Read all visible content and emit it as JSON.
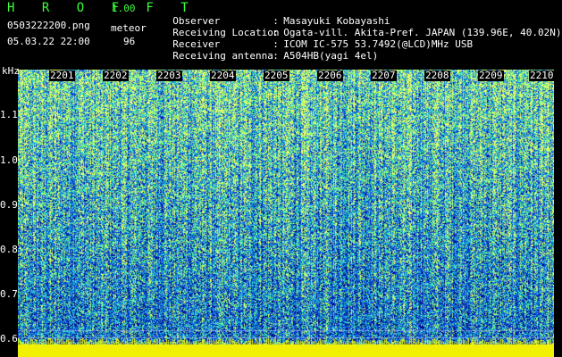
{
  "header": {
    "app_title": "H R O F F T",
    "version": "1.00",
    "filename": "0503222200.png",
    "mode": "meteor",
    "datetime": "05.03.22 22:00",
    "count": "96"
  },
  "info": [
    {
      "key": "Observer",
      "value": "Masayuki Kobayashi"
    },
    {
      "key": "Receiving Location",
      "value": "Ogata-vill. Akita-Pref. JAPAN (139.96E, 40.02N)"
    },
    {
      "key": "Receiver",
      "value": "ICOM IC-575 53.7492(@LCD)MHz USB"
    },
    {
      "key": "Receiving antenna",
      "value": "A504HB(yagi 4el)"
    }
  ],
  "info_separator": ":",
  "spectrogram": {
    "y_unit": "kHz",
    "y_ticks": [
      "1.1",
      "1.0",
      "0.9",
      "0.8",
      "0.7",
      "0.6"
    ],
    "x_ticks": [
      "2201",
      "2202",
      "2203",
      "2204",
      "2205",
      "2206",
      "2207",
      "2208",
      "2209",
      "2210"
    ],
    "colors": {
      "low": "#000060",
      "mid": "#1e5cff",
      "high": "#30ffd0",
      "peak": "#f0f000",
      "text": "#ffffff",
      "accent": "#3cff3c"
    }
  }
}
